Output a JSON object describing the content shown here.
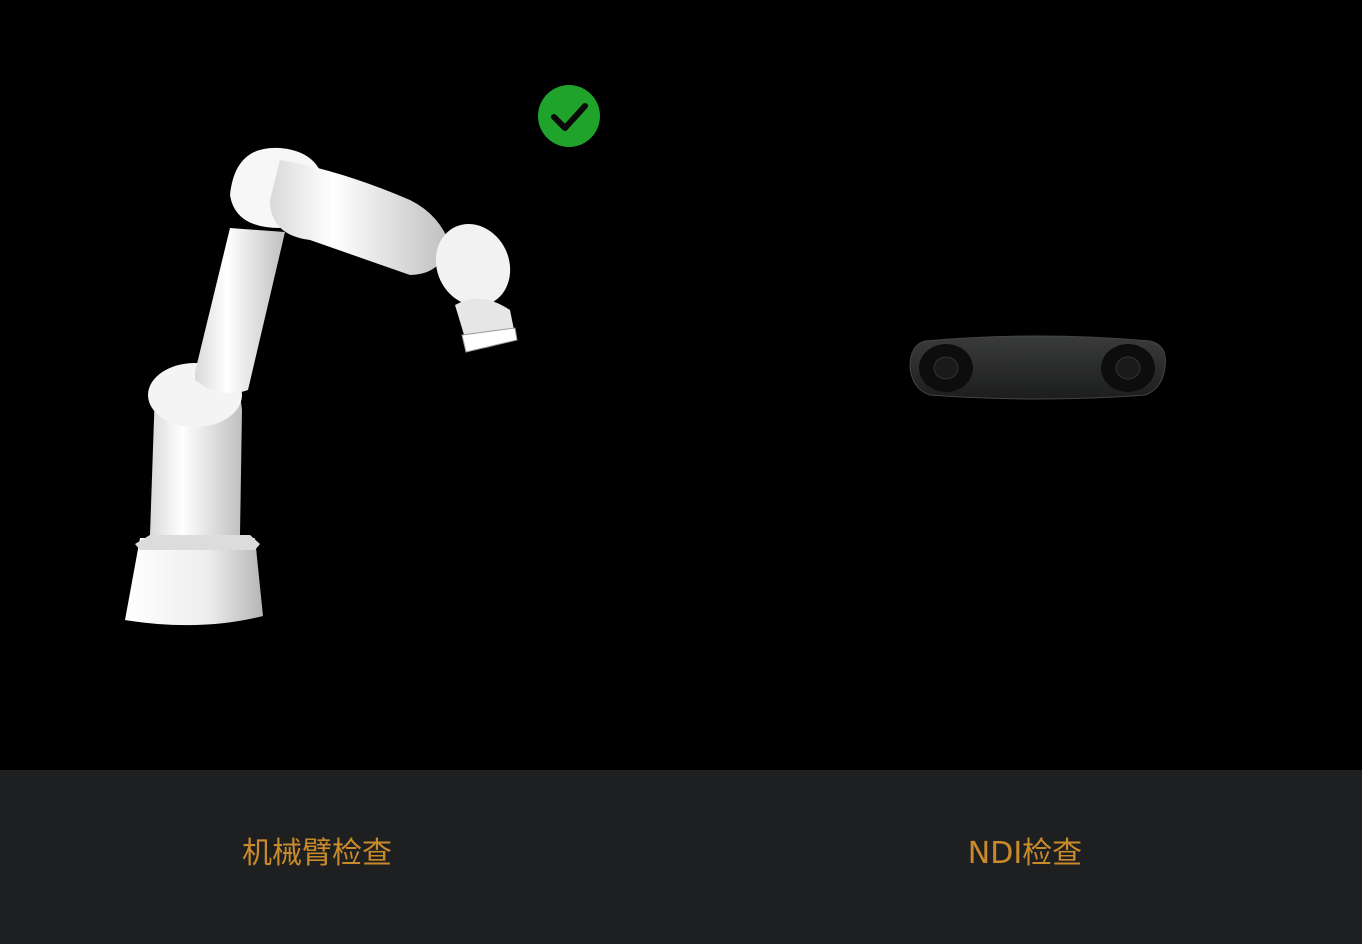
{
  "panels": {
    "robot_arm": {
      "label": "机械臂检查",
      "status": "check-passed",
      "status_icon": "check-circle-icon",
      "illustration_icon": "robot-arm-icon"
    },
    "ndi": {
      "label": "NDI检查",
      "illustration_icon": "ndi-tracker-camera-icon"
    }
  },
  "colors": {
    "background": "#000000",
    "footer": "#1e1f21",
    "label_text": "#c98a2b",
    "status_ok": "#1fa32b",
    "robot_body": "#f2f2f2",
    "camera_body": "#2a2b2b"
  }
}
